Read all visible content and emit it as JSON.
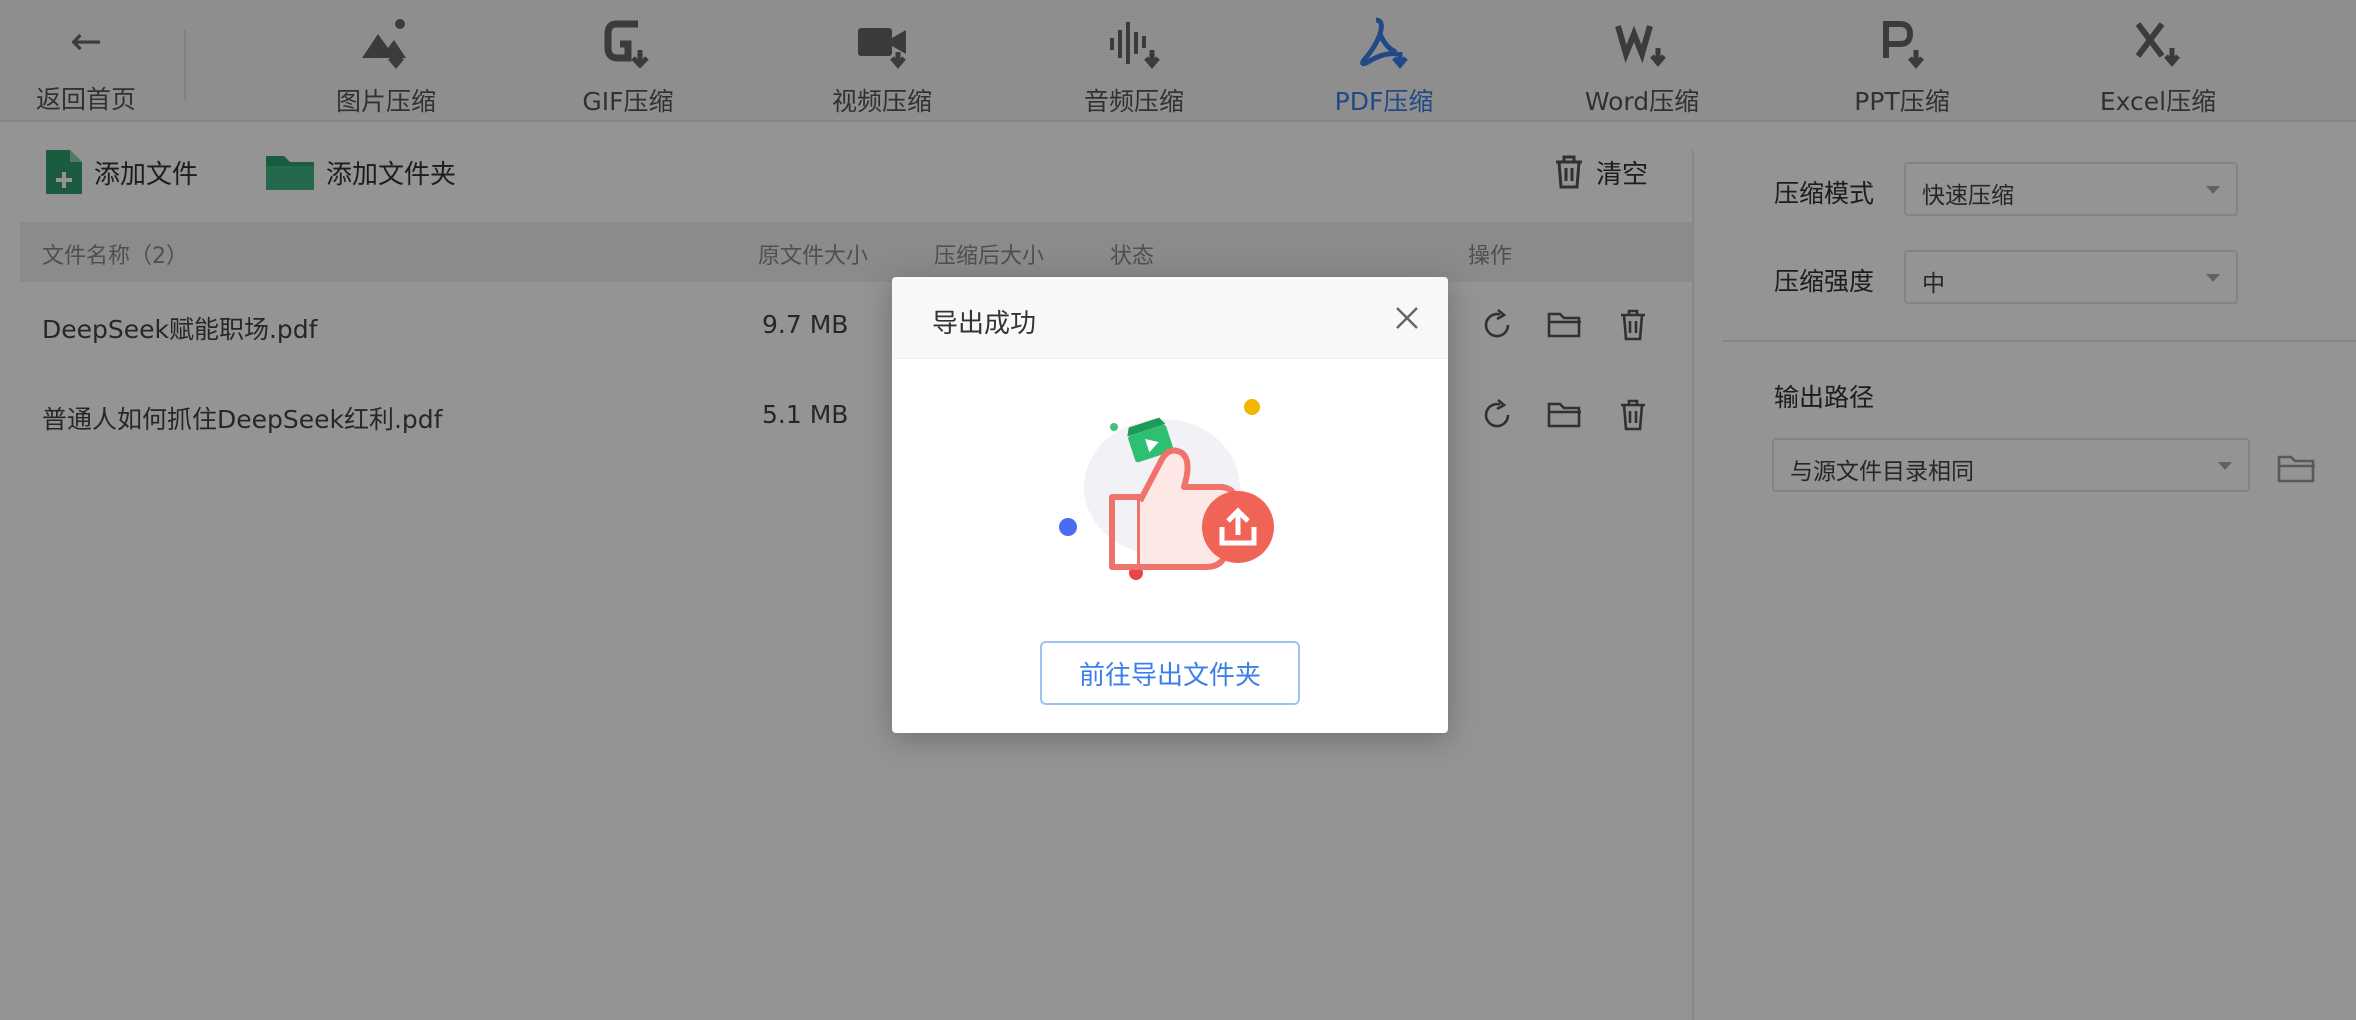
{
  "toolbar": {
    "back_label": "返回首页",
    "tools": [
      {
        "label": "图片压缩"
      },
      {
        "label": "GIF压缩"
      },
      {
        "label": "视频压缩"
      },
      {
        "label": "音频压缩"
      },
      {
        "label": "PDF压缩"
      },
      {
        "label": "Word压缩"
      },
      {
        "label": "PPT压缩"
      },
      {
        "label": "Excel压缩"
      }
    ],
    "active_tool": "PDF压缩",
    "accent_color": "#3c7fe8"
  },
  "actions": {
    "add_file": "添加文件",
    "add_folder": "添加文件夹",
    "clear": "清空"
  },
  "table": {
    "headers": {
      "name": "文件名称（2）",
      "original_size": "原文件大小",
      "compressed_size": "压缩后大小",
      "status": "状态",
      "actions": "操作"
    },
    "rows": [
      {
        "name": "DeepSeek赋能职场.pdf",
        "original_size": "9.7 MB"
      },
      {
        "name": "普通人如何抓住DeepSeek红利.pdf",
        "original_size": "5.1 MB"
      }
    ]
  },
  "settings": {
    "mode_label": "压缩模式",
    "mode_value": "快速压缩",
    "strength_label": "压缩强度",
    "strength_value": "中",
    "output_label": "输出路径",
    "output_value": "与源文件目录相同"
  },
  "dialog": {
    "title": "导出成功",
    "button": "前往导出文件夹"
  }
}
